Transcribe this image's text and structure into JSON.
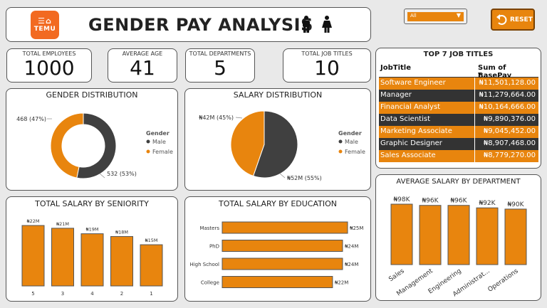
{
  "header": {
    "logo_top": "☰⌂",
    "logo_text": "TEMU",
    "title": "GENDER PAY ANALYSIS"
  },
  "filter": {
    "selected": "All"
  },
  "reset": {
    "label": "RESET"
  },
  "kpis": [
    {
      "label": "TOTAL EMPLOYEES",
      "value": "1000"
    },
    {
      "label": "AVERAGE AGE",
      "value": "41"
    },
    {
      "label": "TOTAL DEPARTMENTS",
      "value": "5"
    },
    {
      "label": "TOTAL JOB TITLES",
      "value": "10"
    }
  ],
  "top_jobs": {
    "title": "TOP 7 JOB TITLES",
    "col1": "JobTitle",
    "col2": "Sum of BasePay",
    "rows": [
      {
        "job": "Software Engineer",
        "pay": "₦11,501,128.00"
      },
      {
        "job": "Manager",
        "pay": "₦11,279,664.00"
      },
      {
        "job": "Financial Analyst",
        "pay": "₦10,164,666.00"
      },
      {
        "job": "Data Scientist",
        "pay": "₦9,890,376.00"
      },
      {
        "job": "Marketing Associate",
        "pay": "₦9,045,452.00"
      },
      {
        "job": "Graphic Designer",
        "pay": "₦8,907,468.00"
      },
      {
        "job": "Sales Associate",
        "pay": "₦8,779,270.00"
      }
    ]
  },
  "colors": {
    "male": "#404040",
    "female": "#e8850e",
    "bar": "#e8850e",
    "dark_row": "#333333"
  },
  "chart_data": [
    {
      "type": "pie",
      "variant": "donut",
      "title": "GENDER DISTRIBUTION",
      "legend_title": "Gender",
      "legend_position": "right",
      "labels": [
        "Male",
        "Female"
      ],
      "values": [
        532,
        468
      ],
      "data_labels": [
        "532 (53%)",
        "468 (47%)"
      ]
    },
    {
      "type": "pie",
      "title": "SALARY DISTRIBUTION",
      "legend_title": "Gender",
      "legend_position": "right",
      "labels": [
        "Male",
        "Female"
      ],
      "values": [
        52,
        42
      ],
      "data_labels": [
        "₦52M (55%)",
        "₦42M (45%)"
      ]
    },
    {
      "type": "bar",
      "title": "TOTAL SALARY BY SENIORITY",
      "categories": [
        "5",
        "3",
        "4",
        "2",
        "1"
      ],
      "values": [
        22,
        21,
        19,
        18,
        15
      ],
      "data_labels": [
        "₦22M",
        "₦21M",
        "₦19M",
        "₦18M",
        "₦15M"
      ]
    },
    {
      "type": "bar",
      "orientation": "horizontal",
      "title": "TOTAL SALARY BY EDUCATION",
      "categories": [
        "Masters",
        "PhD",
        "High School",
        "College"
      ],
      "values": [
        25,
        24,
        24,
        22
      ],
      "data_labels": [
        "₦25M",
        "₦24M",
        "₦24M",
        "₦22M"
      ]
    },
    {
      "type": "bar",
      "title": "AVERAGE SALARY BY DEPARTMENT",
      "categories": [
        "Sales",
        "Management",
        "Engineering",
        "Administrat...",
        "Operations"
      ],
      "values": [
        98,
        96,
        96,
        92,
        90
      ],
      "data_labels": [
        "₦98K",
        "₦96K",
        "₦96K",
        "₦92K",
        "₦90K"
      ]
    }
  ]
}
